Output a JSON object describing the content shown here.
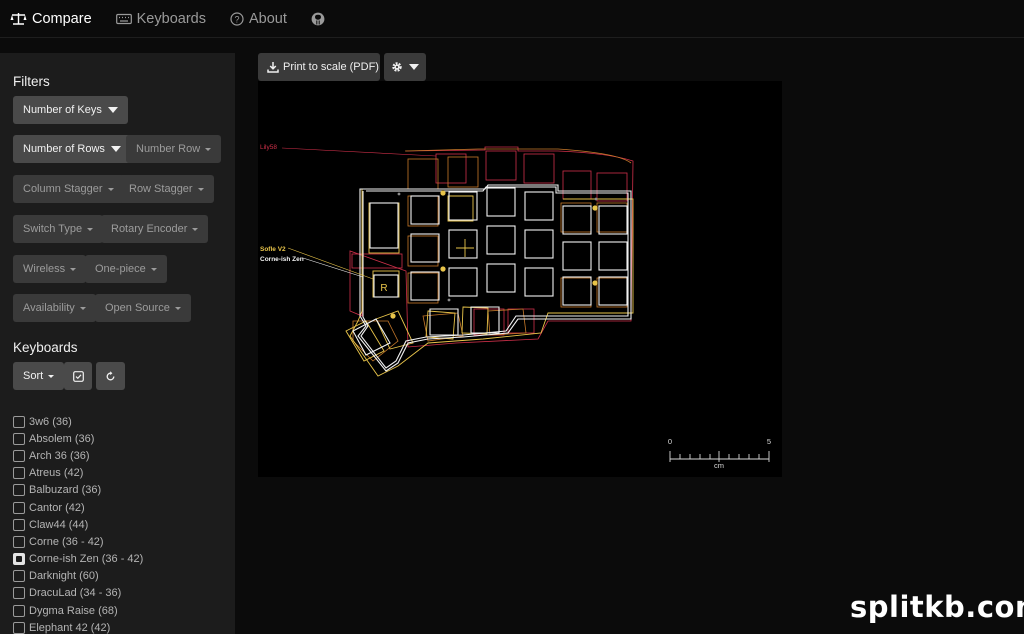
{
  "nav": {
    "compare": "Compare",
    "keyboards": "Keyboards",
    "about": "About"
  },
  "filters": {
    "title": "Filters",
    "buttons": [
      {
        "label": "Number of Keys",
        "active": true
      },
      {
        "label": "Number of Rows",
        "active": true
      },
      {
        "label": "Number Row",
        "active": false
      },
      {
        "label": "Column Stagger",
        "active": false
      },
      {
        "label": "Row Stagger",
        "active": false
      },
      {
        "label": "Switch Type",
        "active": false
      },
      {
        "label": "Rotary Encoder",
        "active": false
      },
      {
        "label": "Wireless",
        "active": false
      },
      {
        "label": "One-piece",
        "active": false
      },
      {
        "label": "Availability",
        "active": false
      },
      {
        "label": "Open Source",
        "active": false
      }
    ]
  },
  "keyboards": {
    "title": "Keyboards",
    "sort_label": "Sort",
    "list": [
      {
        "label": "3w6 (36)",
        "checked": false
      },
      {
        "label": "Absolem (36)",
        "checked": false
      },
      {
        "label": "Arch 36 (36)",
        "checked": false
      },
      {
        "label": "Atreus (42)",
        "checked": false
      },
      {
        "label": "Balbuzard (36)",
        "checked": false
      },
      {
        "label": "Cantor (42)",
        "checked": false
      },
      {
        "label": "Claw44 (44)",
        "checked": false
      },
      {
        "label": "Corne (36 - 42)",
        "checked": false
      },
      {
        "label": "Corne-ish Zen (36 - 42)",
        "checked": true
      },
      {
        "label": "Darknight (60)",
        "checked": false
      },
      {
        "label": "DracuLad (34 - 36)",
        "checked": false
      },
      {
        "label": "Dygma Raise (68)",
        "checked": false
      },
      {
        "label": "Elephant 42 (42)",
        "checked": false
      }
    ]
  },
  "toolbar": {
    "print_label": "Print to scale (PDF)"
  },
  "canvas": {
    "labels": {
      "lily58": "Lily58",
      "sofle": "Sofle V2",
      "corne_zen": "Corne-ish Zen",
      "encoder_letter": "R"
    },
    "scale": {
      "start": "0",
      "end": "5",
      "unit": "cm"
    },
    "colors": {
      "lily58": "#d0304a",
      "sofle": "#e8c44a",
      "corne_zen": "#f2f2f2",
      "orange": "#c87a2a"
    }
  },
  "watermark": "splitkb.com"
}
